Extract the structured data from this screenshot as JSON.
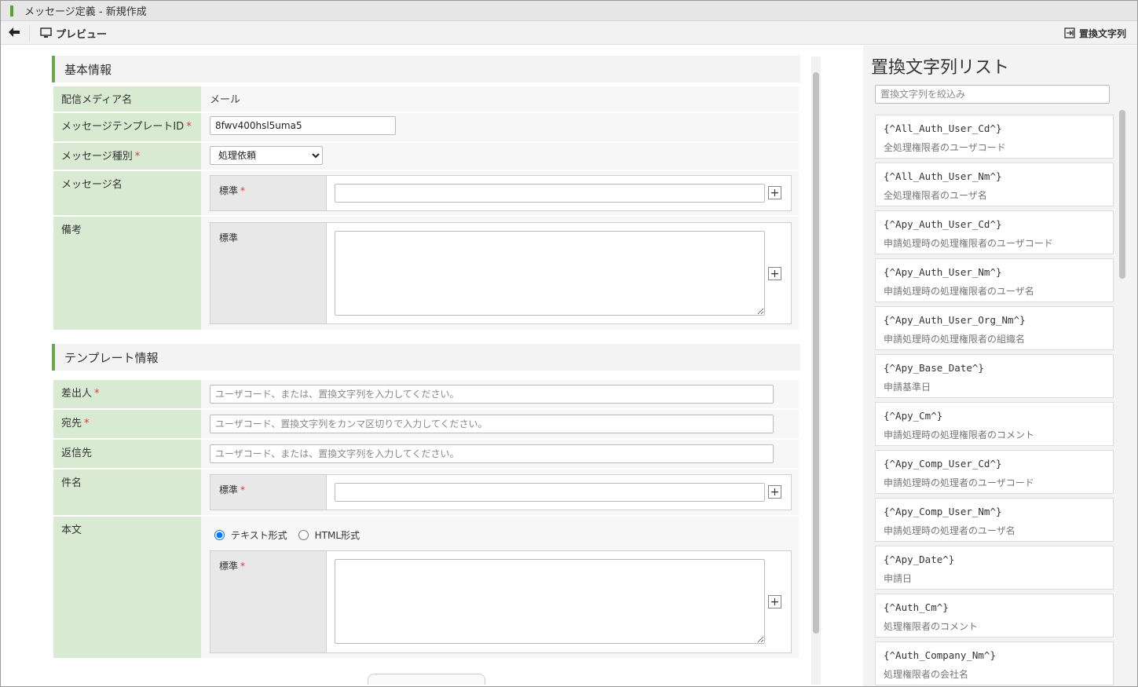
{
  "window": {
    "title": "メッセージ定義 - 新規作成"
  },
  "toolbar": {
    "preview_label": "プレビュー",
    "replace_label": "置換文字列"
  },
  "basic_info": {
    "title": "基本情報",
    "media_label": "配信メディア名",
    "media_value": "メール",
    "template_id_label": "メッセージテンプレートID",
    "template_id_value": "8fwv400hsl5uma5",
    "type_label": "メッセージ種別",
    "type_value": "処理依頼",
    "name_label": "メッセージ名",
    "name_sub_label": "標準",
    "remarks_label": "備考",
    "remarks_sub_label": "標準"
  },
  "template_info": {
    "title": "テンプレート情報",
    "sender_label": "差出人",
    "sender_placeholder": "ユーザコード、または、置換文字列を入力してください。",
    "to_label": "宛先",
    "to_placeholder": "ユーザコード、置換文字列をカンマ区切りで入力してください。",
    "reply_label": "返信先",
    "reply_placeholder": "ユーザコード、または、置換文字列を入力してください。",
    "subject_label": "件名",
    "subject_sub_label": "標準",
    "body_label": "本文",
    "body_format_text": "テキスト形式",
    "body_format_html": "HTML形式",
    "body_sub_label": "標準"
  },
  "required_mark": "*",
  "plus_symbol": "+",
  "sidebar": {
    "title": "置換文字列リスト",
    "filter_placeholder": "置換文字列を絞込み",
    "items": [
      {
        "code": "{^All_Auth_User_Cd^}",
        "desc": "全処理権限者のユーザコード"
      },
      {
        "code": "{^All_Auth_User_Nm^}",
        "desc": "全処理権限者のユーザ名"
      },
      {
        "code": "{^Apy_Auth_User_Cd^}",
        "desc": "申請処理時の処理権限者のユーザコード"
      },
      {
        "code": "{^Apy_Auth_User_Nm^}",
        "desc": "申請処理時の処理権限者のユーザ名"
      },
      {
        "code": "{^Apy_Auth_User_Org_Nm^}",
        "desc": "申請処理時の処理権限者の組織名"
      },
      {
        "code": "{^Apy_Base_Date^}",
        "desc": "申請基準日"
      },
      {
        "code": "{^Apy_Cm^}",
        "desc": "申請処理時の処理権限者のコメント"
      },
      {
        "code": "{^Apy_Comp_User_Cd^}",
        "desc": "申請処理時の処理者のユーザコード"
      },
      {
        "code": "{^Apy_Comp_User_Nm^}",
        "desc": "申請処理時の処理者のユーザ名"
      },
      {
        "code": "{^Apy_Date^}",
        "desc": "申請日"
      },
      {
        "code": "{^Auth_Cm^}",
        "desc": "処理権限者のコメント"
      },
      {
        "code": "{^Auth_Company_Nm^}",
        "desc": "処理権限者の会社名"
      }
    ]
  },
  "colors": {
    "accent_green": "#6aa84f",
    "label_bg": "#d9ead3",
    "required_red": "#e03a3a"
  },
  "icons": {
    "back": "arrow-left-icon",
    "preview": "monitor-icon",
    "replace": "insert-icon"
  }
}
